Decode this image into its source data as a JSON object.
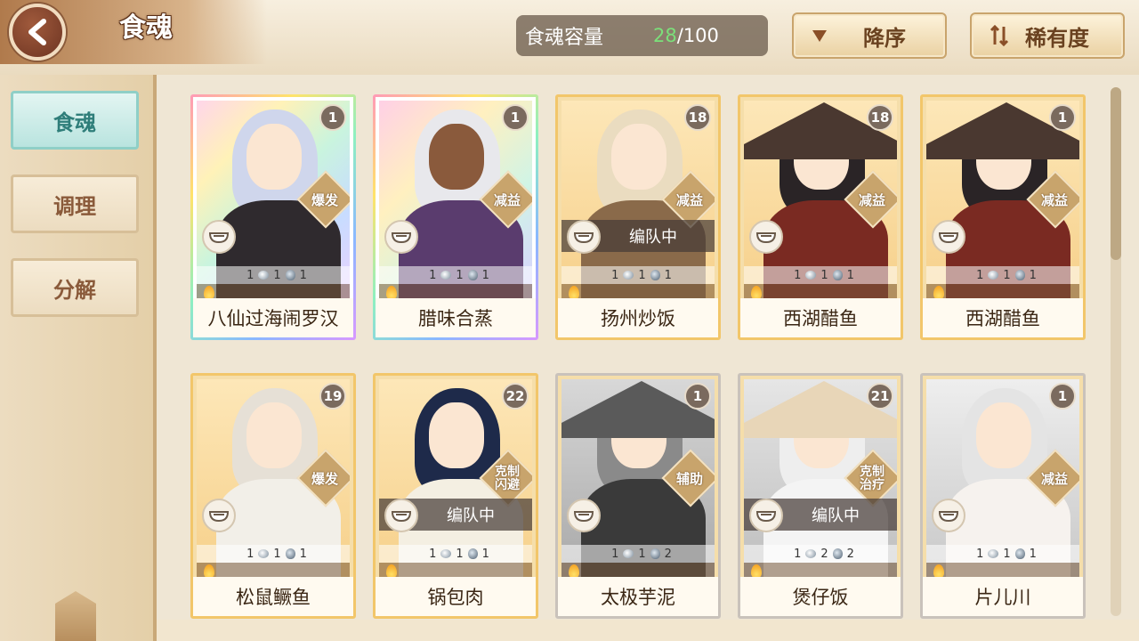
{
  "header": {
    "title": "食魂",
    "capacity_label": "食魂容量",
    "capacity_current": "28",
    "capacity_total": "/100",
    "sort_order_label": "降序",
    "sort_key_label": "稀有度"
  },
  "sidebar": {
    "items": [
      {
        "label": "食魂",
        "active": true
      },
      {
        "label": "调理",
        "active": false
      },
      {
        "label": "分解",
        "active": false
      }
    ]
  },
  "cards": [
    {
      "name": "八仙过海闹罗汉",
      "level": "1",
      "role": "爆发",
      "team": "",
      "stats": [
        "1",
        "1",
        "1"
      ],
      "rarity": "rainbow",
      "theme": "silver-hair"
    },
    {
      "name": "腊味合蒸",
      "level": "1",
      "role": "减益",
      "team": "",
      "stats": [
        "1",
        "1",
        "1"
      ],
      "rarity": "rainbow",
      "theme": "dark-skin"
    },
    {
      "name": "扬州炒饭",
      "level": "18",
      "role": "减益",
      "team": "编队中",
      "stats": [
        "1",
        "1",
        "1"
      ],
      "rarity": "gold",
      "theme": "blonde"
    },
    {
      "name": "西湖醋鱼",
      "level": "18",
      "role": "减益",
      "team": "",
      "stats": [
        "1",
        "1",
        "1"
      ],
      "rarity": "gold",
      "theme": "straw-hat"
    },
    {
      "name": "西湖醋鱼",
      "level": "1",
      "role": "减益",
      "team": "",
      "stats": [
        "1",
        "1",
        "1"
      ],
      "rarity": "gold",
      "theme": "straw-hat"
    },
    {
      "name": "松鼠鳜鱼",
      "level": "19",
      "role": "爆发",
      "team": "",
      "stats": [
        "1",
        "1",
        "1"
      ],
      "rarity": "gold",
      "theme": "fox-mask"
    },
    {
      "name": "锅包肉",
      "level": "22",
      "role": "克制 闪避",
      "team": "编队中",
      "stats": [
        "1",
        "1",
        "1"
      ],
      "rarity": "gold",
      "theme": "navy-hair"
    },
    {
      "name": "太极芋泥",
      "level": "1",
      "role": "辅助",
      "team": "",
      "stats": [
        "1",
        "1",
        "2"
      ],
      "rarity": "gray",
      "theme": "witch"
    },
    {
      "name": "煲仔饭",
      "level": "21",
      "role": "克制 治疗",
      "team": "编队中",
      "stats": [
        "1",
        "2",
        "2"
      ],
      "rarity": "gray",
      "theme": "sun-hat"
    },
    {
      "name": "片儿川",
      "level": "1",
      "role": "减益",
      "team": "",
      "stats": [
        "1",
        "1",
        "1"
      ],
      "rarity": "gray",
      "theme": "white-hair"
    }
  ],
  "colors": {
    "accent_teal": "#8fcfc7",
    "capacity_green": "#7be07a",
    "gold_border": "#f2c66a"
  }
}
